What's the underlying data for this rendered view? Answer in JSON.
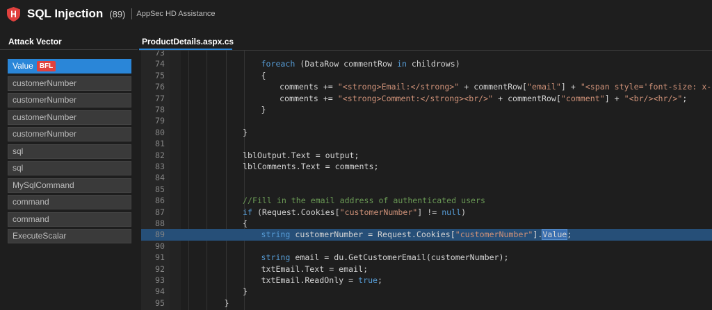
{
  "header": {
    "title": "SQL Injection",
    "count": "(89)",
    "subtitle": "AppSec HD Assistance"
  },
  "colors": {
    "accent": "#2a86d8",
    "badge": "#e0413e",
    "logo": "#e0413e"
  },
  "sidebar": {
    "heading": "Attack Vector",
    "items": [
      {
        "label": "Value",
        "badge": "BFL",
        "selected": true
      },
      {
        "label": "customerNumber"
      },
      {
        "label": "customerNumber"
      },
      {
        "label": "customerNumber"
      },
      {
        "label": "customerNumber"
      },
      {
        "label": "sql"
      },
      {
        "label": "sql"
      },
      {
        "label": "MySqlCommand"
      },
      {
        "label": "command"
      },
      {
        "label": "command"
      },
      {
        "label": "ExecuteScalar"
      }
    ]
  },
  "tab": {
    "label": "ProductDetails.aspx.cs"
  },
  "editor": {
    "lines": [
      {
        "n": "73",
        "i": 0,
        "tokens": []
      },
      {
        "n": "74",
        "i": 1,
        "tokens": [
          {
            "c": "kw",
            "t": "foreach"
          },
          {
            "c": "plain",
            "t": " (DataRow commentRow "
          },
          {
            "c": "kw",
            "t": "in"
          },
          {
            "c": "plain",
            "t": " childrows)"
          }
        ]
      },
      {
        "n": "75",
        "i": 1,
        "tokens": [
          {
            "c": "plain",
            "t": "{"
          }
        ]
      },
      {
        "n": "76",
        "i": 2,
        "tokens": [
          {
            "c": "plain",
            "t": "comments += "
          },
          {
            "c": "str",
            "t": "\"<strong>Email:</strong>\""
          },
          {
            "c": "plain",
            "t": " + commentRow["
          },
          {
            "c": "str",
            "t": "\"email\""
          },
          {
            "c": "plain",
            "t": "] + "
          },
          {
            "c": "str",
            "t": "\"<span style='font-size: x-small"
          }
        ]
      },
      {
        "n": "77",
        "i": 2,
        "tokens": [
          {
            "c": "plain",
            "t": "comments += "
          },
          {
            "c": "str",
            "t": "\"<strong>Comment:</strong><br/>\""
          },
          {
            "c": "plain",
            "t": " + commentRow["
          },
          {
            "c": "str",
            "t": "\"comment\""
          },
          {
            "c": "plain",
            "t": "] + "
          },
          {
            "c": "str",
            "t": "\"<br/><hr/>\""
          },
          {
            "c": "plain",
            "t": ";"
          }
        ]
      },
      {
        "n": "78",
        "i": 1,
        "tokens": [
          {
            "c": "plain",
            "t": "}"
          }
        ]
      },
      {
        "n": "79",
        "i": 0,
        "tokens": []
      },
      {
        "n": "80",
        "i": 0,
        "tokens": [
          {
            "c": "plain",
            "t": "}"
          }
        ]
      },
      {
        "n": "81",
        "i": 0,
        "tokens": []
      },
      {
        "n": "82",
        "i": 0,
        "tokens": [
          {
            "c": "plain",
            "t": "lblOutput.Text = output;"
          }
        ]
      },
      {
        "n": "83",
        "i": 0,
        "tokens": [
          {
            "c": "plain",
            "t": "lblComments.Text = comments;"
          }
        ]
      },
      {
        "n": "84",
        "i": 0,
        "tokens": []
      },
      {
        "n": "85",
        "i": 0,
        "tokens": []
      },
      {
        "n": "86",
        "i": 0,
        "tokens": [
          {
            "c": "cm",
            "t": "//Fill in the email address of authenticated users"
          }
        ]
      },
      {
        "n": "87",
        "i": 0,
        "tokens": [
          {
            "c": "kw",
            "t": "if"
          },
          {
            "c": "plain",
            "t": " (Request.Cookies["
          },
          {
            "c": "str",
            "t": "\"customerNumber\""
          },
          {
            "c": "plain",
            "t": "] != "
          },
          {
            "c": "kw",
            "t": "null"
          },
          {
            "c": "plain",
            "t": ")"
          }
        ]
      },
      {
        "n": "88",
        "i": 0,
        "tokens": [
          {
            "c": "plain",
            "t": "{"
          }
        ]
      },
      {
        "n": "89",
        "i": 1,
        "hl": true,
        "tokens": [
          {
            "c": "kw",
            "t": "string"
          },
          {
            "c": "plain",
            "t": " customerNumber = Request.Cookies["
          },
          {
            "c": "str",
            "t": "\"customerNumber\""
          },
          {
            "c": "plain",
            "t": "]."
          },
          {
            "c": "word-hl",
            "t": "Value"
          },
          {
            "c": "plain",
            "t": ";"
          }
        ]
      },
      {
        "n": "90",
        "i": 0,
        "tokens": []
      },
      {
        "n": "91",
        "i": 1,
        "tokens": [
          {
            "c": "kw",
            "t": "string"
          },
          {
            "c": "plain",
            "t": " email = du.GetCustomerEmail(customerNumber);"
          }
        ]
      },
      {
        "n": "92",
        "i": 1,
        "tokens": [
          {
            "c": "plain",
            "t": "txtEmail.Text = email;"
          }
        ]
      },
      {
        "n": "93",
        "i": 1,
        "tokens": [
          {
            "c": "plain",
            "t": "txtEmail.ReadOnly = "
          },
          {
            "c": "kw",
            "t": "true"
          },
          {
            "c": "plain",
            "t": ";"
          }
        ]
      },
      {
        "n": "94",
        "i": 0,
        "tokens": [
          {
            "c": "plain",
            "t": "}"
          }
        ]
      },
      {
        "n": "95",
        "i": -1,
        "tokens": [
          {
            "c": "plain",
            "t": "}"
          }
        ]
      }
    ]
  }
}
